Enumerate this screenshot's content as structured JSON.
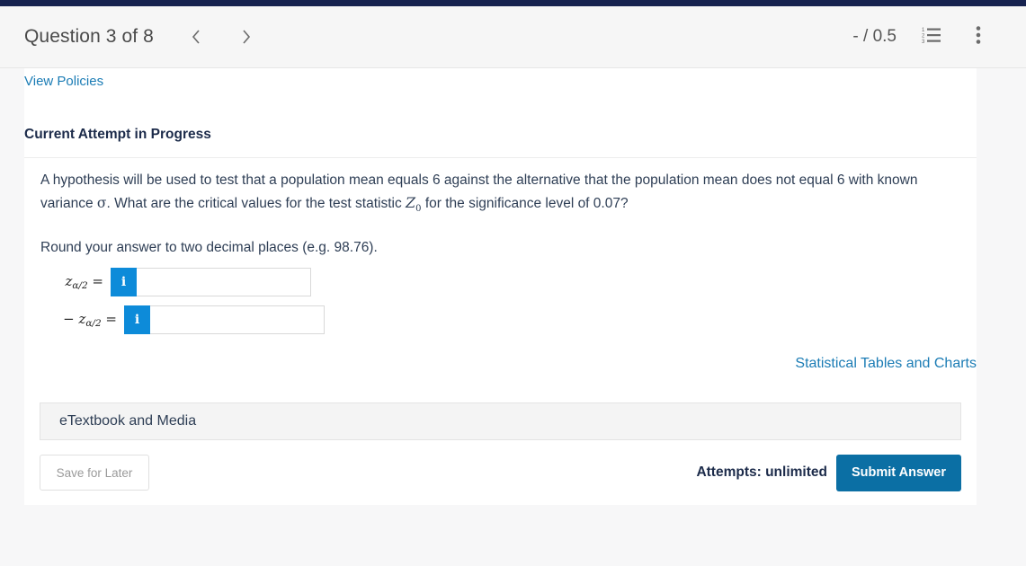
{
  "header": {
    "question_title": "Question 3 of 8",
    "prev_icon": "chevron-left-icon",
    "next_icon": "chevron-right-icon",
    "score": "- / 0.5",
    "list_icon": "numbered-list-icon",
    "menu_icon": "kebab-menu-icon"
  },
  "card": {
    "view_policies": "View Policies",
    "attempt_status": "Current Attempt in Progress",
    "question_part1": "A hypothesis will be used to test that a population mean equals 6 against the alternative that the population mean does not equal 6 with known variance ",
    "sigma": "σ",
    "question_part2": ". What are the critical values for the test statistic ",
    "statistic": "Z",
    "statistic_sub": "0",
    "question_part3": " for the significance level of 0.07?",
    "rounding_note": "Round your answer to two decimal places (e.g. 98.76)."
  },
  "answers": [
    {
      "label_prefix": "",
      "label_var": "z",
      "label_sub": "α/2",
      "label_suffix": " =",
      "info_icon": "info-icon",
      "info_label": "i",
      "value": "",
      "placeholder": ""
    },
    {
      "label_prefix": "− ",
      "label_var": "z",
      "label_sub": "α/2",
      "label_suffix": " =",
      "info_icon": "info-icon",
      "info_label": "i",
      "value": "",
      "placeholder": ""
    }
  ],
  "links": {
    "statistical_tables": "Statistical Tables and Charts"
  },
  "etextbook": {
    "label": "eTextbook and Media"
  },
  "footer": {
    "save_for_later": "Save for Later",
    "attempts": "Attempts: unlimited",
    "submit": "Submit Answer"
  },
  "colors": {
    "navy_bar": "#16224f",
    "link_blue": "#1b7cb5",
    "info_blue": "#0d8bd9",
    "submit_blue": "#0b6fa4",
    "text_navy": "#1c2b4a",
    "page_bg": "#f7f7f8"
  }
}
